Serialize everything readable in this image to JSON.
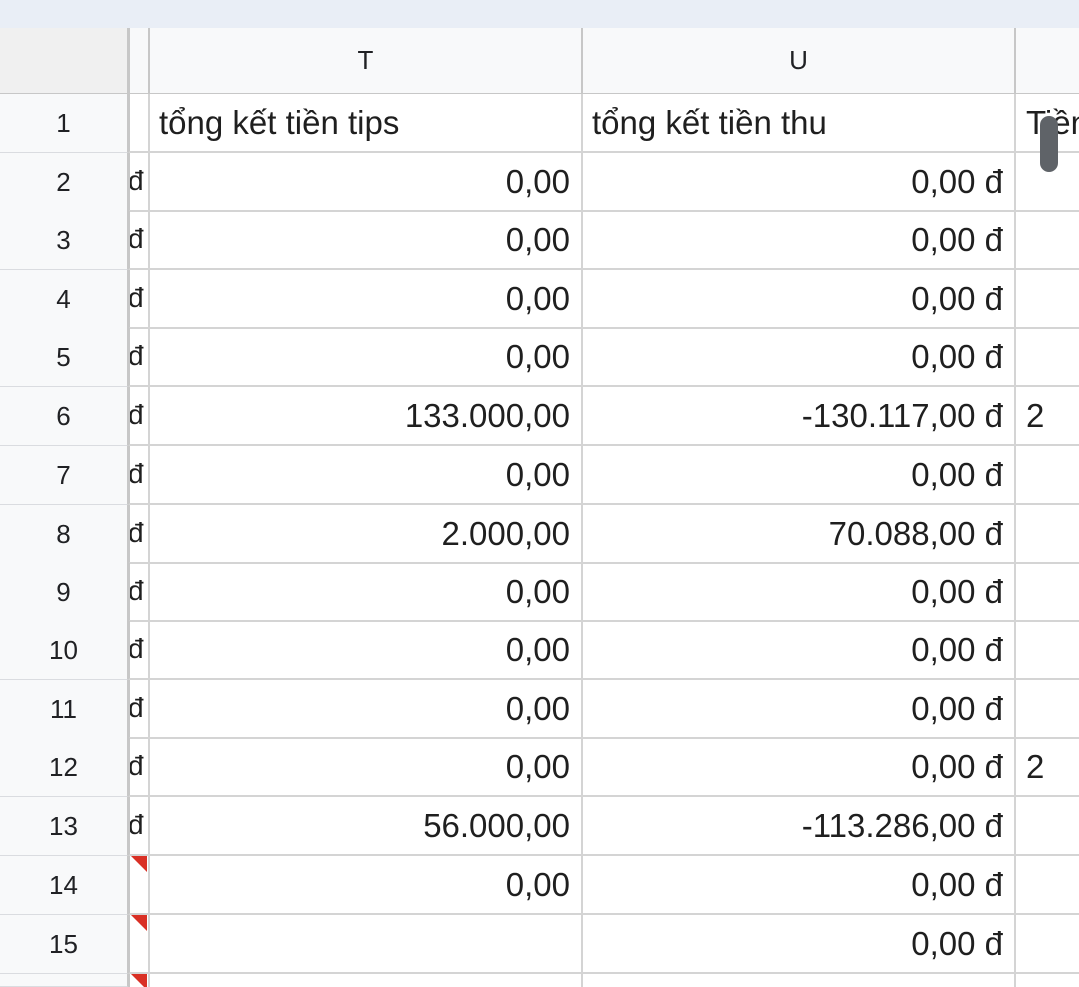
{
  "columns": {
    "t": "T",
    "u": "U"
  },
  "rows": [
    {
      "n": "1",
      "s": "",
      "t": "tổng kết  tiền tips",
      "u": "tổng kết tiền thu",
      "v": "Tiền"
    },
    {
      "n": "2",
      "s": "đ",
      "t": "0,00",
      "u": "0,00 đ",
      "v": ""
    },
    {
      "n": "3",
      "s": "đ",
      "t": "0,00",
      "u": "0,00 đ",
      "v": ""
    },
    {
      "n": "4",
      "s": "đ",
      "t": "0,00",
      "u": "0,00 đ",
      "v": ""
    },
    {
      "n": "5",
      "s": "đ",
      "t": "0,00",
      "u": "0,00 đ",
      "v": ""
    },
    {
      "n": "6",
      "s": "đ",
      "t": "133.000,00",
      "u": "-130.117,00 đ",
      "v": "2"
    },
    {
      "n": "7",
      "s": "đ",
      "t": "0,00",
      "u": "0,00 đ",
      "v": ""
    },
    {
      "n": "8",
      "s": "đ",
      "t": "2.000,00",
      "u": "70.088,00 đ",
      "v": ""
    },
    {
      "n": "9",
      "s": "đ",
      "t": "0,00",
      "u": "0,00 đ",
      "v": ""
    },
    {
      "n": "10",
      "s": "đ",
      "t": "0,00",
      "u": "0,00 đ",
      "v": ""
    },
    {
      "n": "11",
      "s": "đ",
      "t": "0,00",
      "u": "0,00 đ",
      "v": ""
    },
    {
      "n": "12",
      "s": "đ",
      "t": "0,00",
      "u": "0,00 đ",
      "v": "2"
    },
    {
      "n": "13",
      "s": "đ",
      "t": "56.000,00",
      "u": "-113.286,00 đ",
      "v": ""
    },
    {
      "n": "14",
      "s": "",
      "t": "0,00",
      "u": "0,00 đ",
      "v": "",
      "flag": true
    },
    {
      "n": "15",
      "s": "",
      "t": "",
      "u": "0,00 đ",
      "v": "",
      "flag": true
    }
  ],
  "colors": {
    "flag": "#d93025",
    "header_bg": "#f8f9fa",
    "topbar": "#e9eef6"
  }
}
